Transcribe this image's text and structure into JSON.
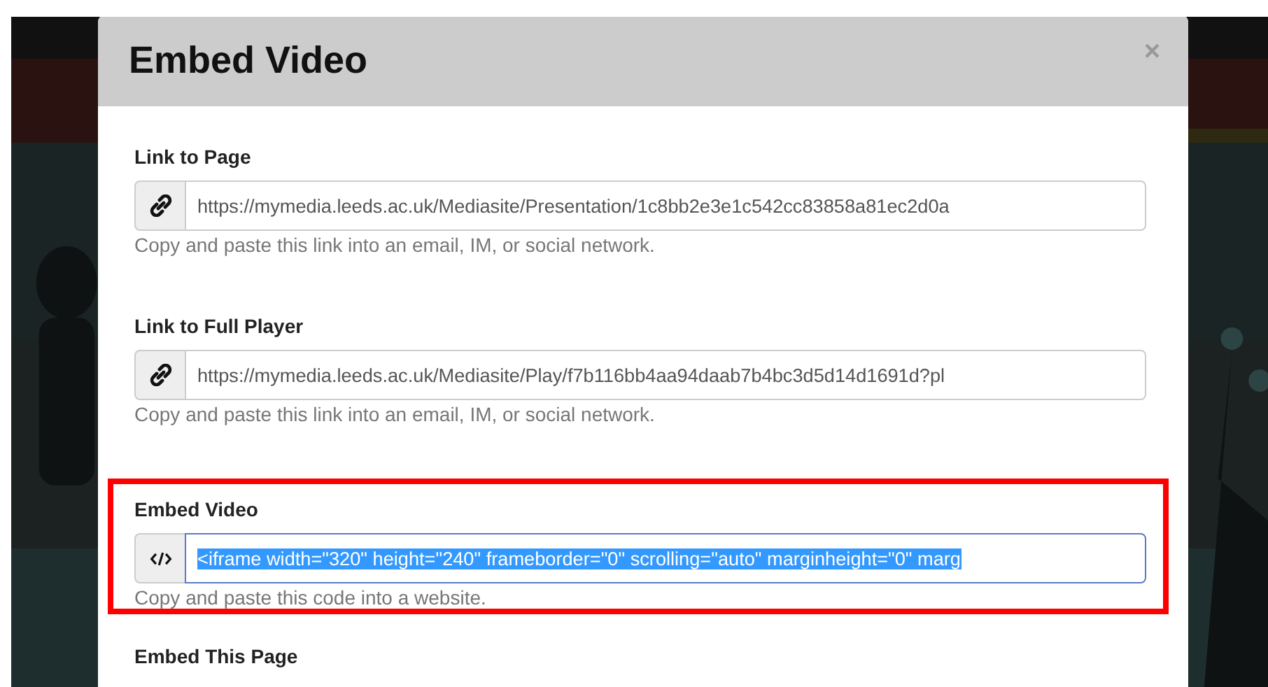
{
  "dialog": {
    "title": "Embed Video",
    "close": "×",
    "sections": [
      {
        "label": "Link to Page",
        "kind": "link",
        "value": "https://mymedia.leeds.ac.uk/Mediasite/Presentation/1c8bb2e3e1c542cc83858a81ec2d0a",
        "focused": false,
        "text_selected": false,
        "help": "Copy and paste this link into an email, IM, or social network.",
        "highlighted": false
      },
      {
        "label": "Link to Full Player",
        "kind": "link",
        "value": "https://mymedia.leeds.ac.uk/Mediasite/Play/f7b116bb4aa94daab7b4bc3d5d14d1691d?pl",
        "focused": false,
        "text_selected": false,
        "help": "Copy and paste this link into an email, IM, or social network.",
        "highlighted": false
      },
      {
        "label": "Embed Video",
        "kind": "code",
        "value": "<iframe width=\"320\" height=\"240\" frameborder=\"0\" scrolling=\"auto\" marginheight=\"0\" marg",
        "focused": true,
        "text_selected": true,
        "help": "Copy and paste this code into a website.",
        "highlighted": true
      },
      {
        "label": "Embed This Page"
      }
    ]
  }
}
